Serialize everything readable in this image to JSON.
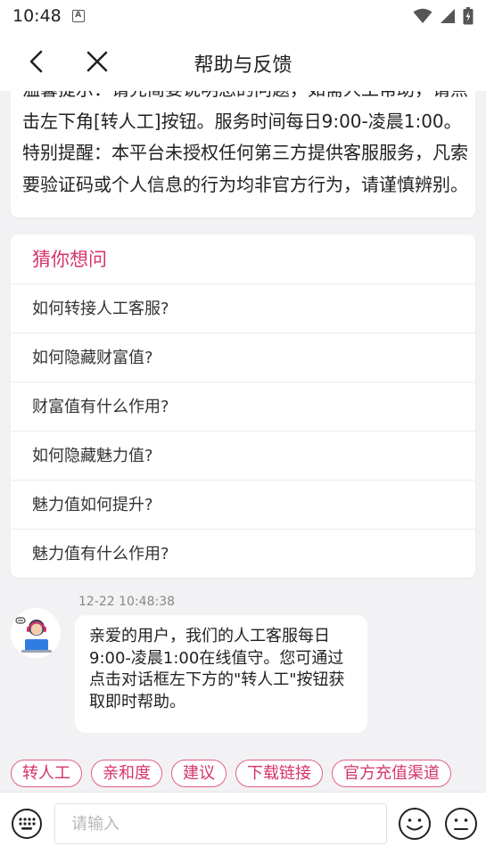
{
  "status_bar": {
    "time": "10:48",
    "notification_glyph": "A"
  },
  "nav": {
    "title": "帮助与反馈"
  },
  "tip": {
    "text": "温馨提示：请先简要说明您的问题，如需人工帮助，请点击左下角[转人工]按钮。服务时间每日9:00-凌晨1:00。特别提醒：本平台未授权任何第三方提供客服服务，凡索要验证码或个人信息的行为均非官方行为，请谨慎辨别。"
  },
  "faq": {
    "title": "猜你想问",
    "items": [
      "如何转接人工客服?",
      "如何隐藏财富值?",
      "财富值有什么作用?",
      "如何隐藏魅力值?",
      "魅力值如何提升?",
      "魅力值有什么作用?"
    ]
  },
  "message": {
    "time": "12-22 10:48:38",
    "text": "亲爱的用户，我们的人工客服每日9:00-凌晨1:00在线值守。您可通过点击对话框左下方的\"转人工\"按钮获取即时帮助。"
  },
  "quick_actions": [
    "转人工",
    "亲和度",
    "建议",
    "下载链接",
    "官方充值渠道"
  ],
  "input": {
    "placeholder": "请输入",
    "value": ""
  },
  "colors": {
    "accent": "#d6336c",
    "chip_border": "#e0608a",
    "background": "#f2f2f4"
  }
}
